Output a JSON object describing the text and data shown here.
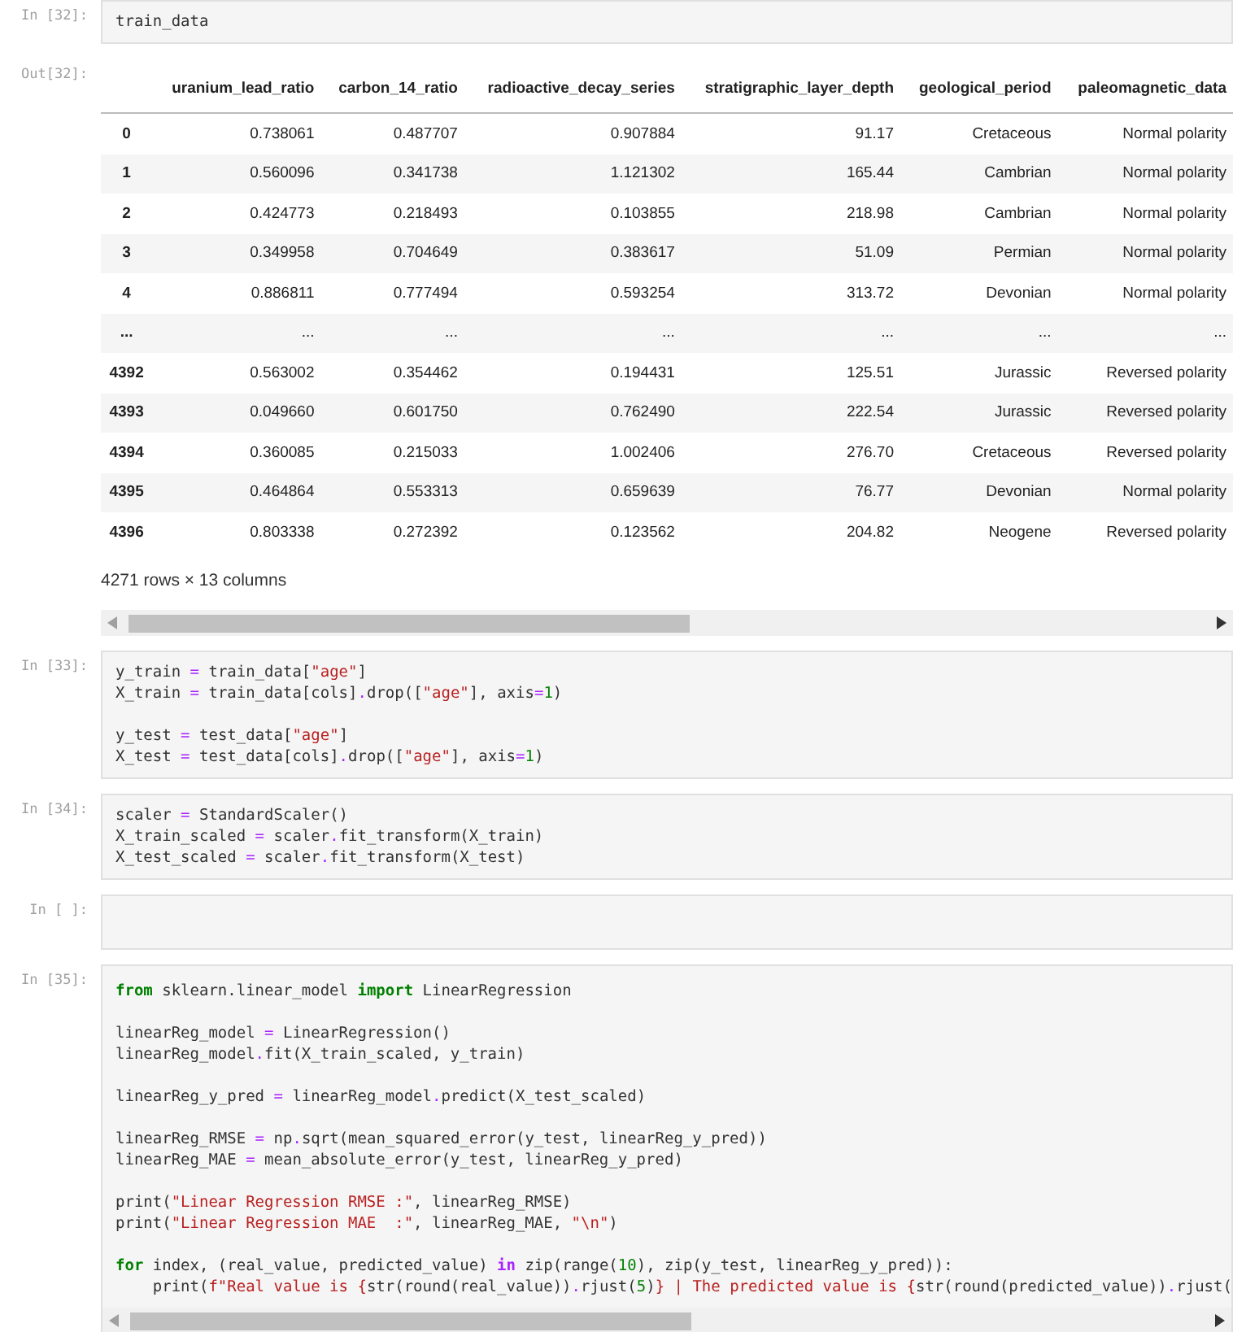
{
  "cells": [
    {
      "kind": "code",
      "prompt": "In [32]:",
      "blocks": [
        [
          [
            {
              "kind": "name",
              "text": "train_data"
            }
          ]
        ]
      ]
    },
    {
      "kind": "table",
      "prompt": "Out[32]:",
      "columns": [
        "uranium_lead_ratio",
        "carbon_14_ratio",
        "radioactive_decay_series",
        "stratigraphic_layer_depth",
        "geological_period",
        "paleomagnetic_data"
      ],
      "rows": [
        {
          "index": "0",
          "cells": [
            "0.738061",
            "0.487707",
            "0.907884",
            "91.17",
            "Cretaceous",
            "Normal polarity"
          ]
        },
        {
          "index": "1",
          "cells": [
            "0.560096",
            "0.341738",
            "1.121302",
            "165.44",
            "Cambrian",
            "Normal polarity"
          ]
        },
        {
          "index": "2",
          "cells": [
            "0.424773",
            "0.218493",
            "0.103855",
            "218.98",
            "Cambrian",
            "Normal polarity"
          ]
        },
        {
          "index": "3",
          "cells": [
            "0.349958",
            "0.704649",
            "0.383617",
            "51.09",
            "Permian",
            "Normal polarity"
          ]
        },
        {
          "index": "4",
          "cells": [
            "0.886811",
            "0.777494",
            "0.593254",
            "313.72",
            "Devonian",
            "Normal polarity"
          ]
        },
        {
          "index": "...",
          "cells": [
            "...",
            "...",
            "...",
            "...",
            "...",
            "..."
          ]
        },
        {
          "index": "4392",
          "cells": [
            "0.563002",
            "0.354462",
            "0.194431",
            "125.51",
            "Jurassic",
            "Reversed polarity"
          ]
        },
        {
          "index": "4393",
          "cells": [
            "0.049660",
            "0.601750",
            "0.762490",
            "222.54",
            "Jurassic",
            "Reversed polarity"
          ]
        },
        {
          "index": "4394",
          "cells": [
            "0.360085",
            "0.215033",
            "1.002406",
            "276.70",
            "Cretaceous",
            "Reversed polarity"
          ]
        },
        {
          "index": "4395",
          "cells": [
            "0.464864",
            "0.553313",
            "0.659639",
            "76.77",
            "Devonian",
            "Normal polarity"
          ]
        },
        {
          "index": "4396",
          "cells": [
            "0.803338",
            "0.272392",
            "0.123562",
            "204.82",
            "Neogene",
            "Reversed polarity"
          ]
        }
      ],
      "summary": "4271 rows × 13 columns"
    },
    {
      "kind": "code",
      "prompt": "In [33]:",
      "blocks": [
        [
          [
            {
              "kind": "name",
              "text": "y_train "
            },
            {
              "kind": "operator",
              "text": "="
            },
            {
              "kind": "name",
              "text": " train_data["
            },
            {
              "kind": "string",
              "text": "\"age\""
            },
            {
              "kind": "name",
              "text": "]"
            }
          ],
          [
            {
              "kind": "name",
              "text": "X_train "
            },
            {
              "kind": "operator",
              "text": "="
            },
            {
              "kind": "name",
              "text": " train_data[cols]"
            },
            {
              "kind": "operator",
              "text": "."
            },
            {
              "kind": "name",
              "text": "drop(["
            },
            {
              "kind": "string",
              "text": "\"age\""
            },
            {
              "kind": "name",
              "text": "], axis"
            },
            {
              "kind": "operator",
              "text": "="
            },
            {
              "kind": "number",
              "text": "1"
            },
            {
              "kind": "name",
              "text": ")"
            }
          ]
        ],
        [
          [
            {
              "kind": "name",
              "text": "y_test "
            },
            {
              "kind": "operator",
              "text": "="
            },
            {
              "kind": "name",
              "text": " test_data["
            },
            {
              "kind": "string",
              "text": "\"age\""
            },
            {
              "kind": "name",
              "text": "]"
            }
          ],
          [
            {
              "kind": "name",
              "text": "X_test "
            },
            {
              "kind": "operator",
              "text": "="
            },
            {
              "kind": "name",
              "text": " test_data[cols]"
            },
            {
              "kind": "operator",
              "text": "."
            },
            {
              "kind": "name",
              "text": "drop(["
            },
            {
              "kind": "string",
              "text": "\"age\""
            },
            {
              "kind": "name",
              "text": "], axis"
            },
            {
              "kind": "operator",
              "text": "="
            },
            {
              "kind": "number",
              "text": "1"
            },
            {
              "kind": "name",
              "text": ")"
            }
          ]
        ]
      ]
    },
    {
      "kind": "code",
      "prompt": "In [34]:",
      "blocks": [
        [
          [
            {
              "kind": "name",
              "text": "scaler "
            },
            {
              "kind": "operator",
              "text": "="
            },
            {
              "kind": "name",
              "text": " StandardScaler()"
            }
          ],
          [
            {
              "kind": "name",
              "text": "X_train_scaled "
            },
            {
              "kind": "operator",
              "text": "="
            },
            {
              "kind": "name",
              "text": " scaler"
            },
            {
              "kind": "operator",
              "text": "."
            },
            {
              "kind": "name",
              "text": "fit_transform(X_train)"
            }
          ],
          [
            {
              "kind": "name",
              "text": "X_test_scaled "
            },
            {
              "kind": "operator",
              "text": "="
            },
            {
              "kind": "name",
              "text": " scaler"
            },
            {
              "kind": "operator",
              "text": "."
            },
            {
              "kind": "name",
              "text": "fit_transform(X_test)"
            }
          ]
        ]
      ]
    },
    {
      "kind": "code",
      "prompt": "In [ ]:"
    },
    {
      "kind": "code",
      "prompt": "In [35]:",
      "scrollbar": true,
      "blocks": [
        [
          [
            {
              "kind": "keyword",
              "text": "from"
            },
            {
              "kind": "name",
              "text": " sklearn.linear_model "
            },
            {
              "kind": "keyword",
              "text": "import"
            },
            {
              "kind": "name",
              "text": " LinearRegression"
            }
          ]
        ],
        [
          [
            {
              "kind": "name",
              "text": "linearReg_model "
            },
            {
              "kind": "operator",
              "text": "="
            },
            {
              "kind": "name",
              "text": " LinearRegression()"
            }
          ],
          [
            {
              "kind": "name",
              "text": "linearReg_model"
            },
            {
              "kind": "operator",
              "text": "."
            },
            {
              "kind": "name",
              "text": "fit(X_train_scaled, y_train)"
            }
          ]
        ],
        [
          [
            {
              "kind": "name",
              "text": "linearReg_y_pred "
            },
            {
              "kind": "operator",
              "text": "="
            },
            {
              "kind": "name",
              "text": " linearReg_model"
            },
            {
              "kind": "operator",
              "text": "."
            },
            {
              "kind": "name",
              "text": "predict(X_test_scaled)"
            }
          ]
        ],
        [
          [
            {
              "kind": "name",
              "text": "linearReg_RMSE "
            },
            {
              "kind": "operator",
              "text": "="
            },
            {
              "kind": "name",
              "text": " np"
            },
            {
              "kind": "operator",
              "text": "."
            },
            {
              "kind": "name",
              "text": "sqrt(mean_squared_error(y_test, linearReg_y_pred))"
            }
          ],
          [
            {
              "kind": "name",
              "text": "linearReg_MAE "
            },
            {
              "kind": "operator",
              "text": "="
            },
            {
              "kind": "name",
              "text": " mean_absolute_error(y_test, linearReg_y_pred)"
            }
          ]
        ],
        [
          [
            {
              "kind": "name",
              "text": "print("
            },
            {
              "kind": "string",
              "text": "\"Linear Regression RMSE :\""
            },
            {
              "kind": "name",
              "text": ", linearReg_RMSE)"
            }
          ],
          [
            {
              "kind": "name",
              "text": "print("
            },
            {
              "kind": "string",
              "text": "\"Linear Regression MAE  :\""
            },
            {
              "kind": "name",
              "text": ", linearReg_MAE, "
            },
            {
              "kind": "string",
              "text": "\"\\n\""
            },
            {
              "kind": "name",
              "text": ")"
            }
          ]
        ],
        [
          [
            {
              "kind": "keyword",
              "text": "for"
            },
            {
              "kind": "name",
              "text": " index, (real_value, predicted_value) "
            },
            {
              "kind": "word",
              "text": "in"
            },
            {
              "kind": "name",
              "text": " zip(range("
            },
            {
              "kind": "number",
              "text": "10"
            },
            {
              "kind": "name",
              "text": "), zip(y_test, linearReg_y_pred)):"
            }
          ],
          [
            {
              "kind": "name",
              "text": "    print("
            },
            {
              "kind": "string",
              "text": "f\"Real value is {"
            },
            {
              "kind": "name",
              "text": "str(round(real_value))"
            },
            {
              "kind": "operator",
              "text": "."
            },
            {
              "kind": "name",
              "text": "rjust("
            },
            {
              "kind": "number",
              "text": "5"
            },
            {
              "kind": "name",
              "text": ")"
            },
            {
              "kind": "string",
              "text": "} | The predicted value is {"
            },
            {
              "kind": "name",
              "text": "str(round(predicted_value))"
            },
            {
              "kind": "operator",
              "text": "."
            },
            {
              "kind": "name",
              "text": "rjust("
            }
          ]
        ]
      ]
    }
  ]
}
